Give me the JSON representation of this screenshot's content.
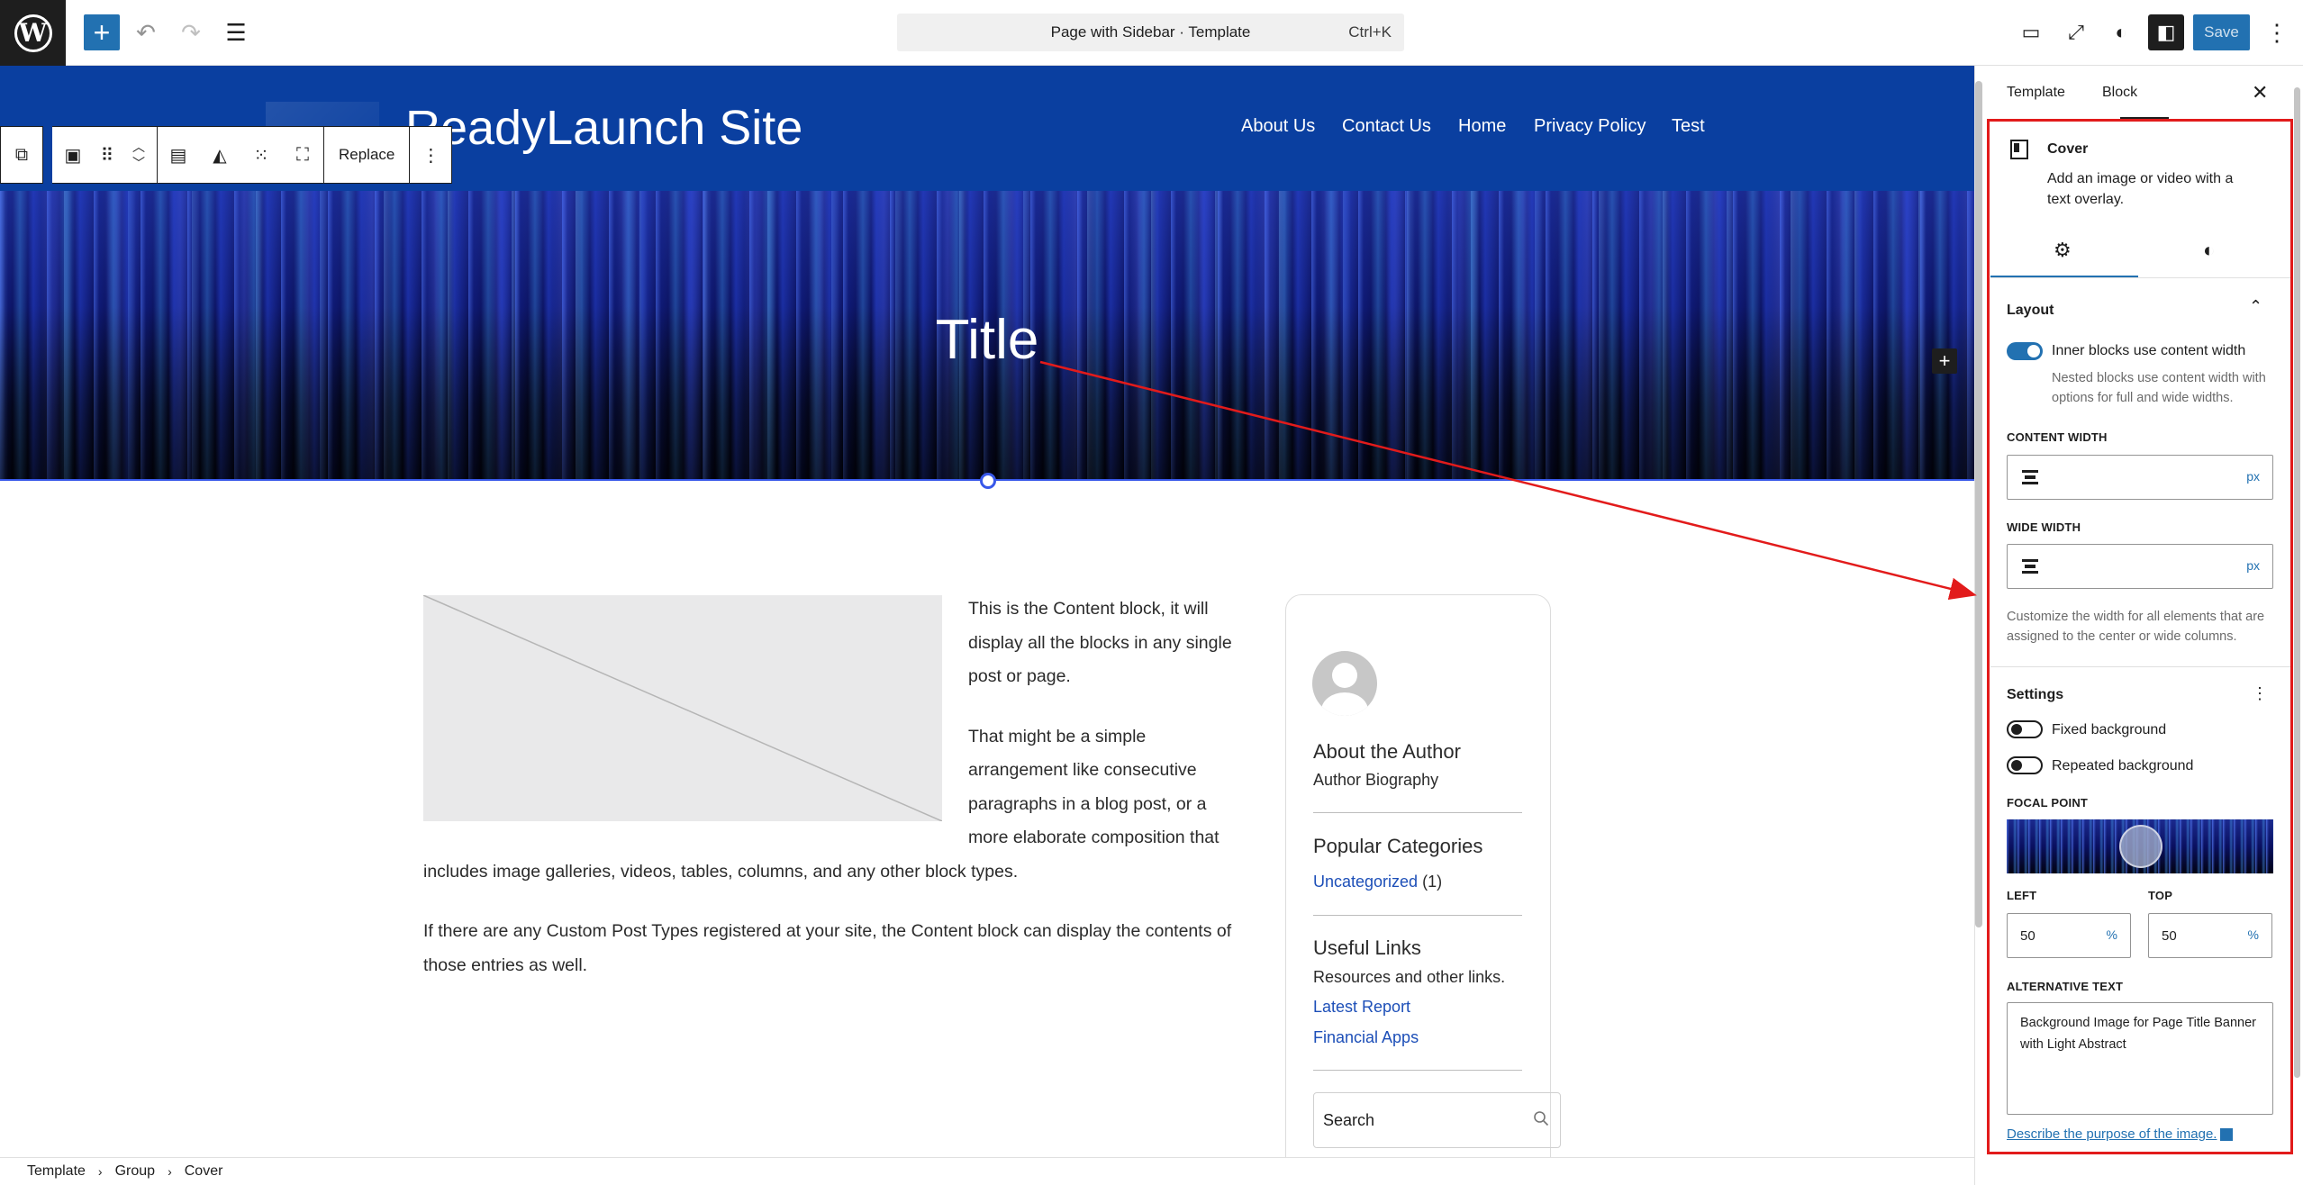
{
  "topbar": {
    "command_title": "Page with Sidebar · Template",
    "command_shortcut": "Ctrl+K",
    "save_label": "Save",
    "icons": [
      "wordpress-icon",
      "plus-icon",
      "undo-icon",
      "redo-icon",
      "list-view-icon",
      "desktop-icon",
      "expand-icon",
      "contrast-icon",
      "sidebar-toggle-icon",
      "more-vertical-icon"
    ]
  },
  "site": {
    "title": "ReadyLaunch Site",
    "nav": [
      "About Us",
      "Contact Us",
      "Home",
      "Privacy Policy",
      "Test"
    ]
  },
  "block_toolbar": {
    "replace_label": "Replace"
  },
  "cover": {
    "title": "Title"
  },
  "content": {
    "p1": "This is the Content block, it will display all the blocks in any single post or page.",
    "p2_lines": [
      "That might be a simple",
      "arrangement like consecutive",
      "paragraphs in a blog post, or a",
      "more elaborate composition that"
    ],
    "p2_tail": "includes image galleries, videos, tables, columns, and any other block types.",
    "p3": "If there are any Custom Post Types registered at your site, the Content block can display the contents of those entries as well."
  },
  "sidebar": {
    "about_heading": "About the Author",
    "about_text": "Author Biography",
    "categories_heading": "Popular Categories",
    "category_link": "Uncategorized",
    "category_count": "(1)",
    "links_heading": "Useful Links",
    "links_text": "Resources and other links.",
    "links": [
      "Latest Report",
      "Financial Apps"
    ],
    "search_placeholder": "Search"
  },
  "breadcrumb": [
    "Template",
    "Group",
    "Cover"
  ],
  "panel": {
    "tabs": [
      "Template",
      "Block"
    ],
    "block_name": "Cover",
    "block_desc": "Add an image or video with a text overlay.",
    "layout_heading": "Layout",
    "inner_blocks_label": "Inner blocks use content width",
    "inner_blocks_help": "Nested blocks use content width with options for full and wide widths.",
    "content_width_label": "CONTENT WIDTH",
    "wide_width_label": "WIDE WIDTH",
    "unit": "px",
    "width_help": "Customize the width for all elements that are assigned to the center or wide columns.",
    "settings_heading": "Settings",
    "fixed_bg_label": "Fixed background",
    "repeated_bg_label": "Repeated background",
    "focal_label": "FOCAL POINT",
    "left_label": "LEFT",
    "top_label": "TOP",
    "left_value": "50",
    "top_value": "50",
    "percent": "%",
    "alt_label": "ALTERNATIVE TEXT",
    "alt_value": "Background Image for Page Title Banner with Light Abstract",
    "alt_link": "Describe the purpose of the image.",
    "inner_blocks_on": true,
    "fixed_bg_on": false,
    "repeated_bg_on": false
  },
  "colors": {
    "accent": "#2271b1",
    "header_bg": "#0a3fa0",
    "annotation": "#e21b1b"
  }
}
